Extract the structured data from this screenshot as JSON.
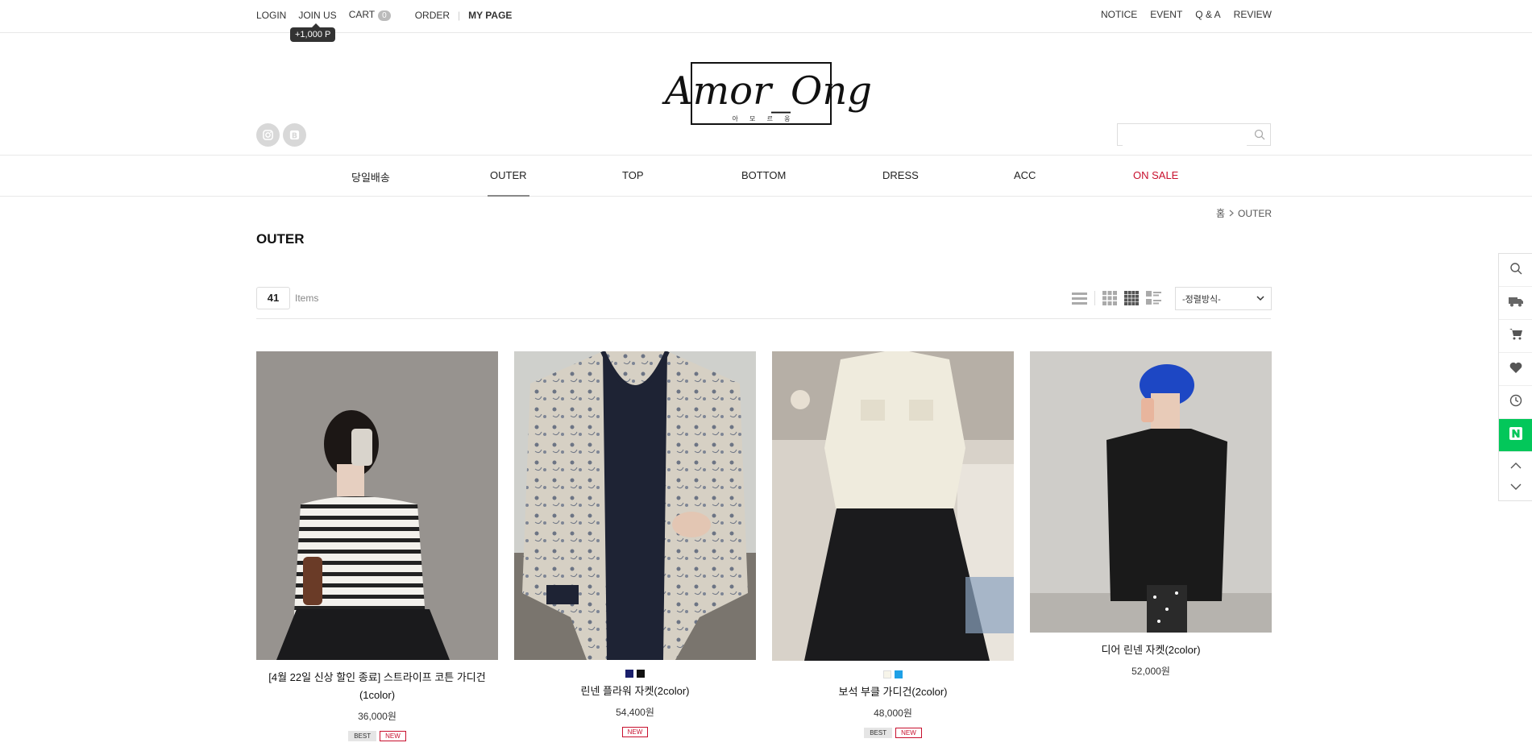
{
  "topbar": {
    "login": "LOGIN",
    "join": "JOIN US",
    "cart": "CART",
    "cart_count": "0",
    "order": "ORDER",
    "mypage": "MY PAGE",
    "point_tip": "+1,000 P",
    "notice": "NOTICE",
    "event": "EVENT",
    "qna": "Q & A",
    "review": "REVIEW"
  },
  "brand": {
    "name": "Amor_Ong",
    "sub": "아 모 르 옹"
  },
  "nav": [
    "당일배송",
    "OUTER",
    "TOP",
    "BOTTOM",
    "DRESS",
    "ACC",
    "ON SALE"
  ],
  "breadcrumb": {
    "home": "홈",
    "current": "OUTER"
  },
  "page_title": "OUTER",
  "listing": {
    "count": "41",
    "count_label": "Items",
    "sort_label": "-정렬방식-"
  },
  "products": [
    {
      "name": "[4월 22일 신상 할인 종료] 스트라이프 코튼 가디건 (1color)",
      "price": "36,000원",
      "swatches": [],
      "badges": [
        "BEST",
        "NEW"
      ]
    },
    {
      "name": "린넨 플라워 자켓(2color)",
      "price": "54,400원",
      "swatches": [
        "#1a1f6b",
        "#111111"
      ],
      "badges": [
        "NEW"
      ]
    },
    {
      "name": "보석 부클 가디건(2color)",
      "price": "48,000원",
      "swatches": [
        "#f7f5ea",
        "#1ea0e6"
      ],
      "badges": [
        "BEST",
        "NEW"
      ]
    },
    {
      "name": "디어 린넨 자켓(2color)",
      "price": "52,000원",
      "swatches": [],
      "badges": []
    }
  ],
  "colors": {
    "sale": "#c8102e",
    "naver": "#03c75a"
  }
}
